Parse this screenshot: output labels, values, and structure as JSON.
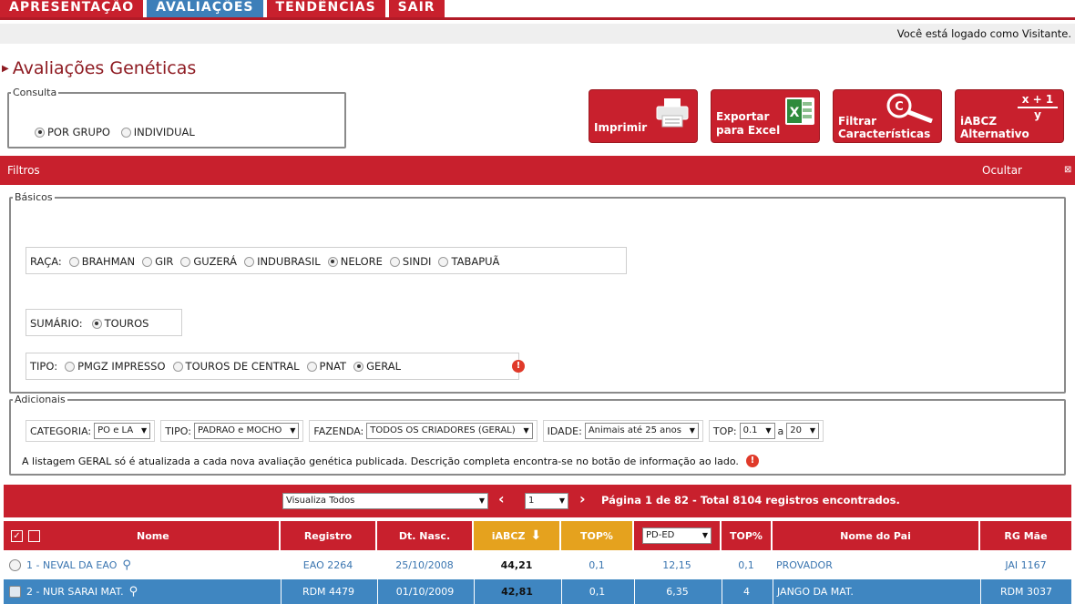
{
  "nav": {
    "tabs": [
      "APRESENTAÇÃO",
      "AVALIAÇÕES",
      "TENDÊNCIAS",
      "SAIR"
    ],
    "active": "AVALIAÇÕES"
  },
  "login_text": "Você está logado como Visitante.",
  "page_title": "Avaliações Genéticas",
  "consulta": {
    "legend": "Consulta",
    "options": [
      "POR GRUPO",
      "INDIVIDUAL"
    ],
    "selected": "POR GRUPO"
  },
  "actions": {
    "imprimir": "Imprimir",
    "exportar_1": "Exportar",
    "exportar_2": "para Excel",
    "filtrar_1": "Filtrar",
    "filtrar_2": "Características",
    "iabcz_1": "iABCZ",
    "iabcz_2": "Alternativo",
    "formula_top": "x + 1",
    "formula_bottom": "y"
  },
  "filtros_bar": {
    "label": "Filtros",
    "toggle": "Ocultar"
  },
  "basicos": {
    "legend": "Básicos",
    "raca_label": "RAÇA:",
    "racas": [
      "BRAHMAN",
      "GIR",
      "GUZERÁ",
      "INDUBRASIL",
      "NELORE",
      "SINDI",
      "TABAPUÃ"
    ],
    "raca_selected": "NELORE",
    "sumario_label": "SUMÁRIO:",
    "sumario_option": "TOUROS",
    "tipo_label": "TIPO:",
    "tipos": [
      "PMGZ IMPRESSO",
      "TOUROS DE CENTRAL",
      "PNAT",
      "GERAL"
    ],
    "tipo_selected": "GERAL"
  },
  "adicionais": {
    "legend": "Adicionais",
    "categoria_label": "CATEGORIA:",
    "categoria_value": "PO e LA",
    "tipo_label": "TIPO:",
    "tipo_value": "PADRAO e MOCHO",
    "fazenda_label": "FAZENDA:",
    "fazenda_value": "TODOS OS CRIADORES (GERAL)",
    "idade_label": "IDADE:",
    "idade_value": "Animais até 25 anos",
    "top_label": "TOP:",
    "top_from": "0.1",
    "top_to": "20",
    "top_sep": "a",
    "note": "A listagem GERAL só é atualizada a cada nova avaliação genética publicada. Descrição completa encontra-se no botão de informação ao lado."
  },
  "results": {
    "view_select": "Visualiza Todos",
    "page_select": "1",
    "summary": "Página 1 de 82 - Total 8104 registros encontrados."
  },
  "table": {
    "headers": {
      "nome": "Nome",
      "registro": "Registro",
      "nasc": "Dt. Nasc.",
      "iabcz": "iABCZ",
      "top1": "TOP%",
      "deca": "PD-ED",
      "top2": "TOP%",
      "pai": "Nome do Pai",
      "mae": "RG Mãe"
    },
    "rows": [
      {
        "nome": "1 - NEVAL DA EAO",
        "registro": "EAO 2264",
        "nasc": "25/10/2008",
        "iabcz": "44,21",
        "top1": "0,1",
        "pded": "12,15",
        "top2": "0,1",
        "pai": "PROVADOR",
        "mae": "JAI 1167"
      },
      {
        "nome": "2 - NUR SARAI MAT.",
        "registro": "RDM 4479",
        "nasc": "01/10/2009",
        "iabcz": "42,81",
        "top1": "0,1",
        "pded": "6,35",
        "top2": "4",
        "pai": "JANGO DA MAT.",
        "mae": "RDM 3037"
      }
    ]
  },
  "colors": {
    "red": "#c8202d",
    "blue": "#3d7fb9",
    "gold": "#e5a21e"
  }
}
